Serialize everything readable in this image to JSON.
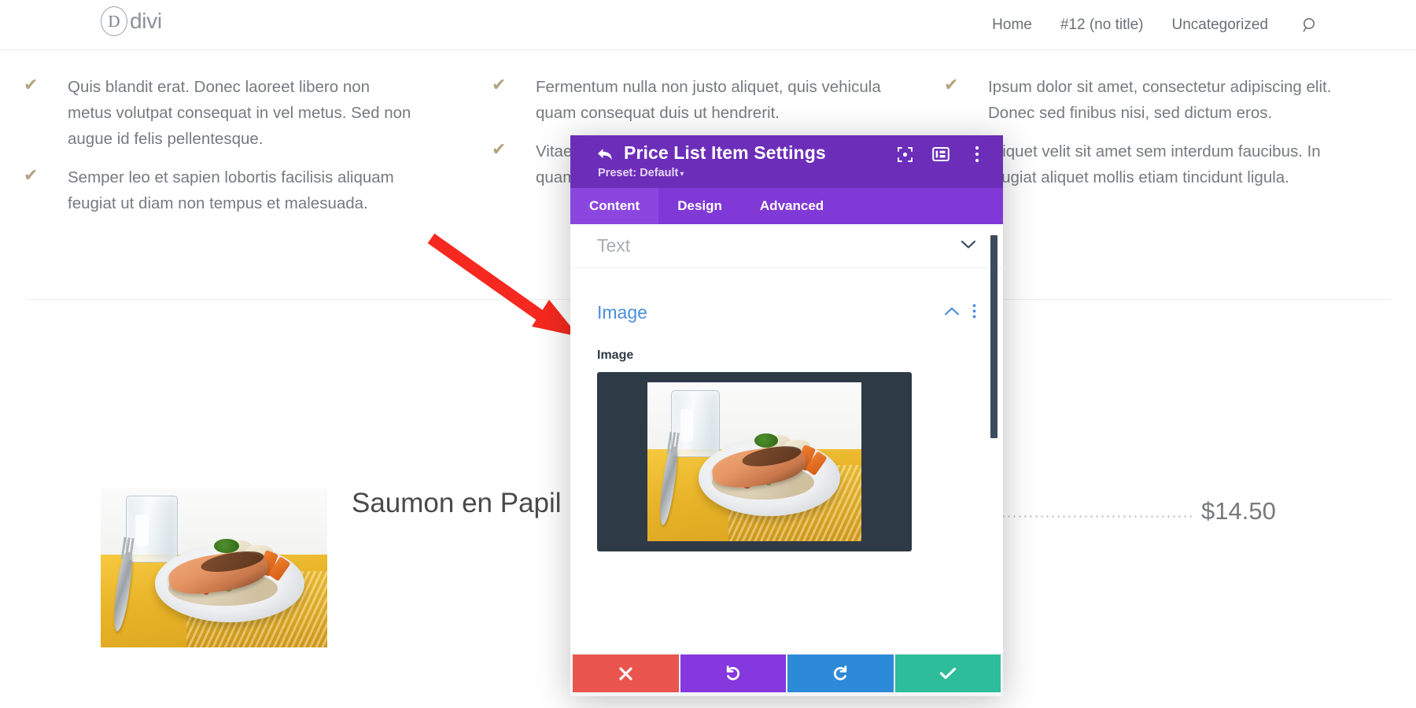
{
  "site": {
    "brand": {
      "mark": "D",
      "name": "divi"
    },
    "nav": [
      {
        "label": "Home",
        "name": "nav-link-home"
      },
      {
        "label": "#12 (no title)",
        "name": "nav-link-post-12"
      },
      {
        "label": "Uncategorized",
        "name": "nav-link-uncategorized"
      }
    ],
    "search_icon": "search-icon"
  },
  "features": {
    "check_color": "#b5a482",
    "columns": [
      {
        "items": [
          "Quis blandit erat. Donec laoreet libero non metus volutpat consequat in vel metus. Sed non augue id felis pellentesque.",
          "Semper leo et sapien lobortis facilisis aliquam feugiat ut diam non tempus et malesuada."
        ]
      },
      {
        "items": [
          "Fermentum nulla non justo aliquet, quis vehicula quam consequat duis ut hendrerit.",
          "Vitae ipsum quam quam urna"
        ]
      },
      {
        "items": [
          "Ipsum dolor sit amet, consectetur adipiscing elit. Donec sed finibus nisi, sed dictum eros.",
          "Aliquet velit sit amet sem interdum faucibus. In feugiat aliquet mollis etiam tincidunt ligula."
        ]
      }
    ]
  },
  "price_list": {
    "item": {
      "title": "Saumon en Papil",
      "price": "$14.50",
      "thumbnail_alt": "salmon-dish-photo"
    }
  },
  "modal": {
    "header": {
      "back_icon": "back-arrow-icon",
      "title": "Price List Item Settings",
      "preset_label": "Preset: Default",
      "preset_caret": "▾",
      "icons": [
        {
          "name": "focus-view-icon"
        },
        {
          "name": "layout-panel-icon"
        },
        {
          "name": "more-options-icon"
        }
      ]
    },
    "tabs": [
      {
        "label": "Content",
        "active": true
      },
      {
        "label": "Design",
        "active": false
      },
      {
        "label": "Advanced",
        "active": false
      }
    ],
    "accordions": [
      {
        "label": "Text",
        "state": "collapsed",
        "chevron": "˅"
      },
      {
        "label": "Image",
        "state": "expanded",
        "chevron": "˄"
      }
    ],
    "image_field": {
      "label": "Image",
      "preview_alt": "salmon-dish-photo"
    },
    "footer": [
      {
        "name": "cancel-button",
        "glyph": "✖",
        "color": "#e9554d"
      },
      {
        "name": "undo-button",
        "glyph": "↺",
        "color": "#8438dd"
      },
      {
        "name": "redo-button",
        "glyph": "↻",
        "color": "#2d8ad8"
      },
      {
        "name": "save-button",
        "glyph": "✔",
        "color": "#2ebd9a"
      }
    ]
  },
  "annotation": {
    "arrow_color": "#f5291f",
    "points_to": "Image section"
  },
  "theme": {
    "modal_header_purple": "#6c2eb9",
    "modal_tabbar_purple": "#8038d6",
    "active_tab_purple": "#8c46e0",
    "accordion_blue": "#4a8fdd",
    "preview_bg": "#2f3a47"
  }
}
